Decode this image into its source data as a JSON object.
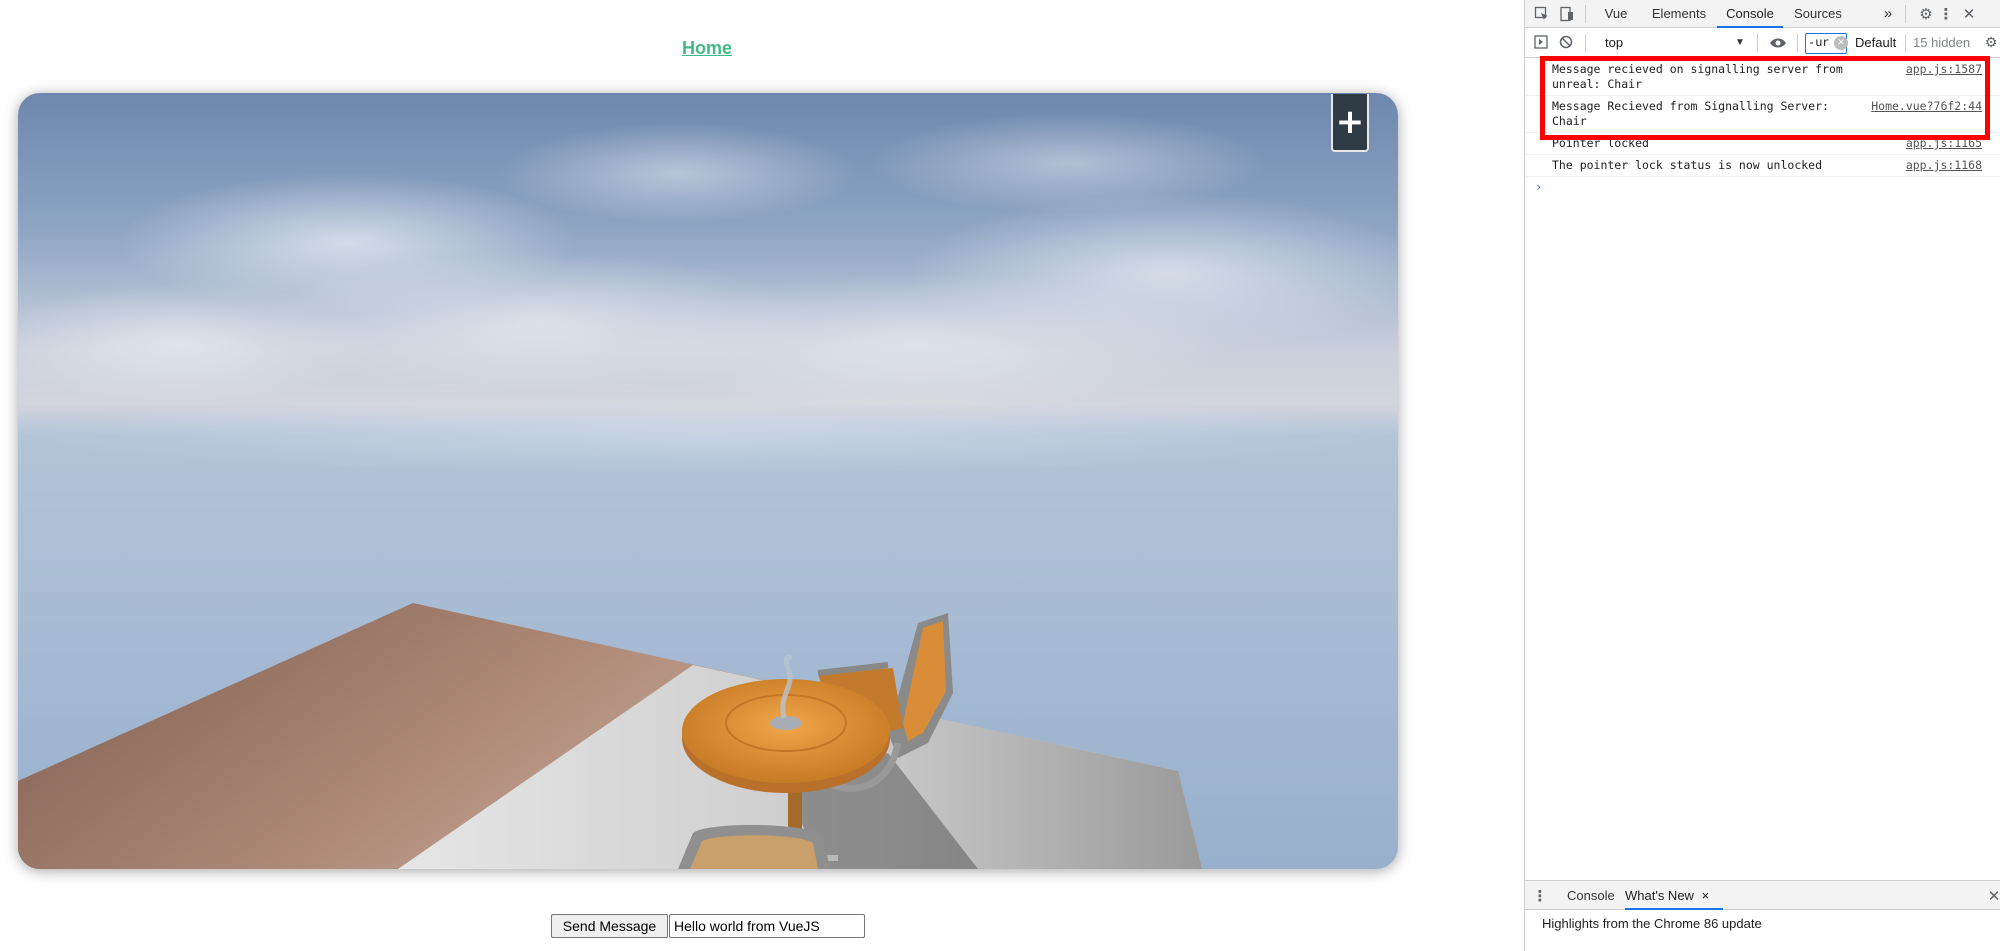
{
  "page": {
    "home_link": "Home",
    "send_button": "Send Message",
    "message_input_value": "Hello world from VueJS",
    "add_button": "+"
  },
  "devtools": {
    "tabs": [
      "Vue",
      "Elements",
      "Console",
      "Sources"
    ],
    "active_tab": "Console",
    "more_tabs": "»",
    "context": "top",
    "filter_value": "-ur",
    "levels": "Default",
    "hidden": "15 hidden",
    "logs": [
      {
        "message": "Message recieved on signalling server from\nunreal: Chair",
        "source": "app.js:1587"
      },
      {
        "message": "Message Recieved from Signalling Server:\nChair",
        "source": "Home.vue?76f2:44"
      },
      {
        "message": "Pointer locked",
        "source": "app.js:1165"
      },
      {
        "message": "The pointer lock status is now unlocked",
        "source": "app.js:1168"
      }
    ],
    "prompt": "›",
    "drawer_tabs": [
      "Console",
      "What's New"
    ],
    "drawer_close": "×",
    "drawer_content": "Highlights from the Chrome 86 update"
  },
  "colors": {
    "link": "#42b983",
    "highlight_box": "#ff0000",
    "devtools_accent": "#1a73e8"
  }
}
